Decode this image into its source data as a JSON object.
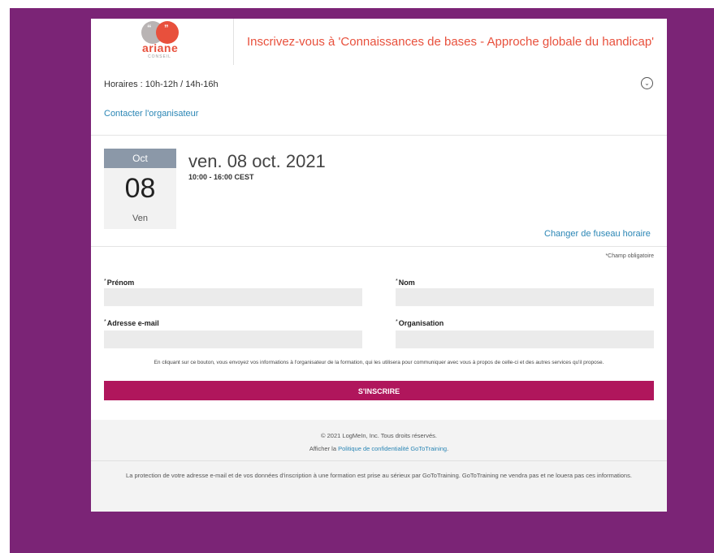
{
  "brand": {
    "name": "ariane",
    "subtitle": "CONSEIL",
    "quote_left": "“",
    "quote_right": "”",
    "accent_color": "#e8503c",
    "frame_color": "#7b2476",
    "button_color": "#b0165c",
    "link_color": "#2b86b5"
  },
  "header": {
    "title": "Inscrivez-vous à 'Connaissances de bases - Approche globale du handicap'"
  },
  "info": {
    "horaires": "Horaires : 10h-12h / 14h-16h",
    "contact_link": "Contacter l'organisateur",
    "expand_icon": "chevron-down-icon"
  },
  "session": {
    "month": "Oct",
    "day": "08",
    "weekday": "Ven",
    "date_full": "ven. 08 oct. 2021",
    "time_range": "10:00 - 16:00 CEST",
    "change_timezone": "Changer de fuseau horaire"
  },
  "form": {
    "required_note": "*Champ obligatoire",
    "asterisk": "*",
    "fields": {
      "prenom_label": "Prénom",
      "nom_label": "Nom",
      "email_label": "Adresse e-mail",
      "organisation_label": "Organisation"
    },
    "disclaimer": "En cliquant sur ce bouton, vous envoyez vos informations à l'organisateur de la formation, qui les utilisera pour communiquer avec vous à propos de celle-ci et des autres services qu'il propose.",
    "submit_label": "S'INSCRIRE"
  },
  "footer": {
    "copyright": "© 2021 LogMeIn, Inc. Tous droits réservés.",
    "privacy_prefix": "Afficher la ",
    "privacy_link": "Politique de confidentialité GoToTraining",
    "privacy_suffix": ".",
    "protection_note": "La protection de votre adresse e-mail et de vos données d'inscription à une formation est prise au sérieux par GoToTraining. GoToTraining ne vendra pas et ne louera pas ces informations."
  }
}
